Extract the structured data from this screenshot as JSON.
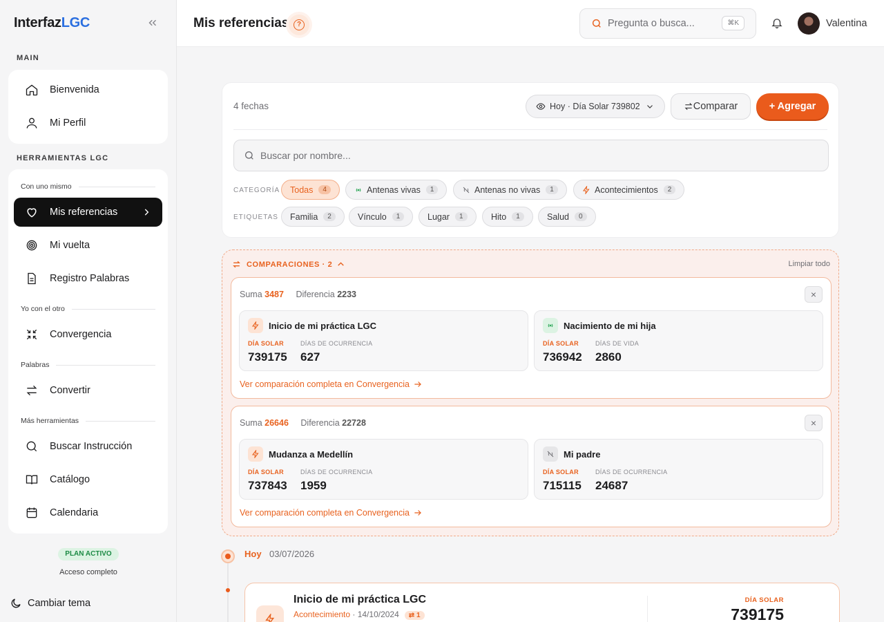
{
  "sidebar": {
    "logo_a": "Interfaz",
    "logo_b": "LGC",
    "main_label": "MAIN",
    "main_items": [
      {
        "label": "Bienvenida",
        "icon": "home-icon"
      },
      {
        "label": "Mi Perfil",
        "icon": "user-icon"
      }
    ],
    "tools_label": "HERRAMIENTAS LGC",
    "groups": {
      "self": "Con uno mismo",
      "other": "Yo con el otro",
      "words": "Palabras",
      "more": "Más herramientas"
    },
    "items": {
      "mis_referencias": "Mis referencias",
      "mi_vuelta": "Mi vuelta",
      "registro": "Registro Palabras",
      "convergencia": "Convergencia",
      "convertir": "Convertir",
      "buscar": "Buscar Instrucción",
      "catalogo": "Catálogo",
      "calendaria": "Calendaria"
    },
    "plan": "PLAN ACTIVO",
    "access": "Acceso completo",
    "theme": "Cambiar tema"
  },
  "header": {
    "title": "Mis referencias",
    "help": "?",
    "search_placeholder": "Pregunta o busca...",
    "shortcut": "⌘K",
    "user": "Valentina"
  },
  "toolbar": {
    "count": "4 fechas",
    "today": "Hoy · Día Solar 739802",
    "compare": "Comparar",
    "add": "+ Agregar",
    "search_placeholder": "Buscar por nombre..."
  },
  "filters": {
    "category_label": "CATEGORÍA",
    "categories": [
      {
        "label": "Todas",
        "count": "4"
      },
      {
        "label": "Antenas vivas",
        "count": "1"
      },
      {
        "label": "Antenas no vivas",
        "count": "1"
      },
      {
        "label": "Acontecimientos",
        "count": "2"
      }
    ],
    "tags_label": "ETIQUETAS",
    "tags": [
      {
        "label": "Familia",
        "count": "2"
      },
      {
        "label": "Vínculo",
        "count": "1"
      },
      {
        "label": "Lugar",
        "count": "1"
      },
      {
        "label": "Hito",
        "count": "1"
      },
      {
        "label": "Salud",
        "count": "0"
      }
    ]
  },
  "comparisons": {
    "header": "COMPARACIONES · 2",
    "clear": "Limpiar todo",
    "sum_label": "Suma",
    "diff_label": "Diferencia",
    "solar_label": "DÍA SOLAR",
    "link": "Ver comparación completa en Convergencia",
    "close": "×",
    "items": [
      {
        "sum": "3487",
        "diff": "2233",
        "a": {
          "name": "Inicio de mi práctica LGC",
          "solar": "739175",
          "label2": "DÍAS DE OCURRENCIA",
          "value2": "627"
        },
        "b": {
          "name": "Nacimiento de mi hija",
          "solar": "736942",
          "label2": "DÍAS DE VIDA",
          "value2": "2860"
        }
      },
      {
        "sum": "26646",
        "diff": "22728",
        "a": {
          "name": "Mudanza a Medellín",
          "solar": "737843",
          "label2": "DÍAS DE OCURRENCIA",
          "value2": "1959"
        },
        "b": {
          "name": "Mi padre",
          "solar": "715115",
          "label2": "DÍAS DE OCURRENCIA",
          "value2": "24687"
        }
      }
    ]
  },
  "timeline": {
    "today": "Hoy",
    "date": "03/07/2026",
    "event": {
      "title": "Inicio de mi práctica LGC",
      "category": "Acontecimiento",
      "date": " · 14/10/2024",
      "badge": "⇄ 1",
      "solar_label": "DÍA SOLAR",
      "solar": "739175"
    }
  },
  "colors": {
    "accent": "#ea5b1c",
    "brand_blue": "#2b6fe0",
    "live_green": "#2fa85a"
  }
}
